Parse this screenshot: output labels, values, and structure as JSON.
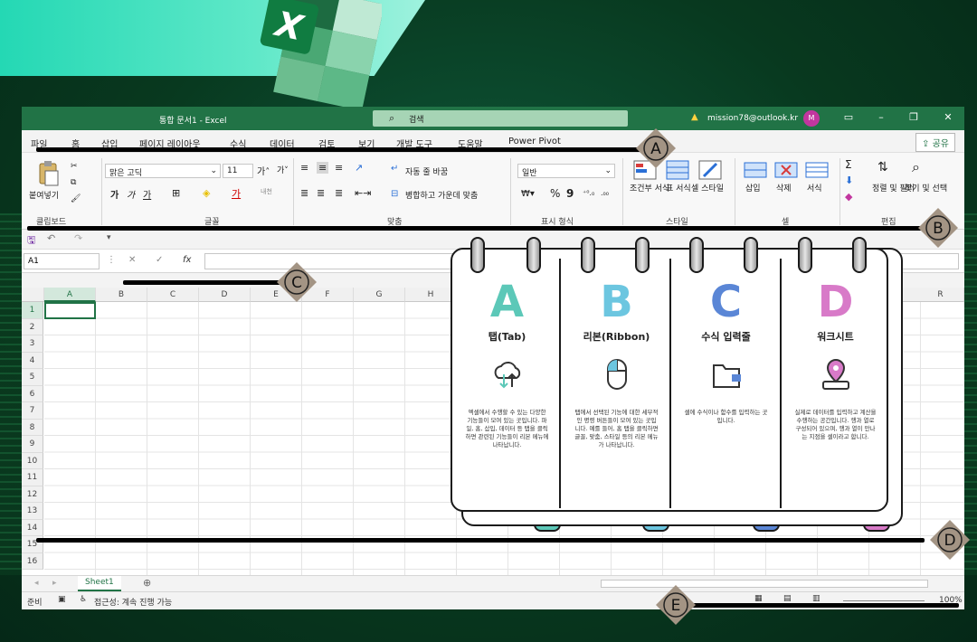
{
  "window": {
    "title": "통합 문서1  -  Excel",
    "search_placeholder": "검색",
    "account": "mission78@outlook.kr",
    "avatar_initial": "M"
  },
  "tabs": [
    "파일",
    "홈",
    "삽입",
    "페이지 레이아웃",
    "수식",
    "데이터",
    "검토",
    "보기",
    "개발 도구",
    "도움말",
    "Power Pivot"
  ],
  "share_label": "공유",
  "ribbon": {
    "paste": "붙여넣기",
    "font_name": "맑은 고딕",
    "font_size": "11",
    "wrap_text": "자동 줄 바꿈",
    "merge_center": "병합하고 가운데 맞춤",
    "number_format": "일반",
    "cond_format": "조건부 서식",
    "table_format": "표 서식",
    "cell_style": "셀 스타일",
    "insert": "삽입",
    "delete": "삭제",
    "format": "서식",
    "sort_filter": "정렬 및 필터",
    "find_select": "찾기 및 선택",
    "groups": [
      "클립보드",
      "글꼴",
      "맞춤",
      "표시 형식",
      "스타일",
      "셀",
      "편집"
    ]
  },
  "namebox": "A1",
  "fx_label": "fx",
  "columns": [
    "A",
    "B",
    "C",
    "D",
    "E",
    "F",
    "G",
    "H",
    "R"
  ],
  "rows": [
    "1",
    "2",
    "3",
    "4",
    "5",
    "6",
    "7",
    "8",
    "9",
    "10",
    "11",
    "12",
    "13",
    "14",
    "15",
    "16"
  ],
  "sheet_tab": "Sheet1",
  "status": {
    "ready": "준비",
    "accessibility": "접근성: 계속 진행 가능",
    "zoom": "100%"
  },
  "markers": [
    "A",
    "B",
    "C",
    "D",
    "E"
  ],
  "card": {
    "columns": [
      {
        "letter": "A",
        "title": "탭(Tab)",
        "color": "#5cc8b8",
        "desc": "엑셀에서 수행할 수 있는 다양한 기능들이 모여 있는 곳입니다. 파일, 홈, 삽입, 데이터 등 탭을 클릭하면 관련된 기능들이 리본 메뉴에 나타납니다."
      },
      {
        "letter": "B",
        "title": "리본(Ribbon)",
        "color": "#6cc6e0",
        "desc": "탭에서 선택된 기능에 대한 세부적인 명령 버튼들이 모여 있는 곳입니다. 예를 들어, 홈 탭을 클릭하면 글꼴, 맞춤, 스타일 등의 리본 메뉴가 나타납니다."
      },
      {
        "letter": "C",
        "title": "수식 입력줄",
        "color": "#5a86d6",
        "desc": "셀에 수식이나 함수를 입력하는 곳입니다."
      },
      {
        "letter": "D",
        "title": "워크시트",
        "color": "#d87ac8",
        "desc": "실제로 데이터를 입력하고 계산을 수행하는 공간입니다. 행과 열로 구성되어 있으며, 행과 열이 만나는 지점을 셀이라고 합니다."
      }
    ]
  }
}
